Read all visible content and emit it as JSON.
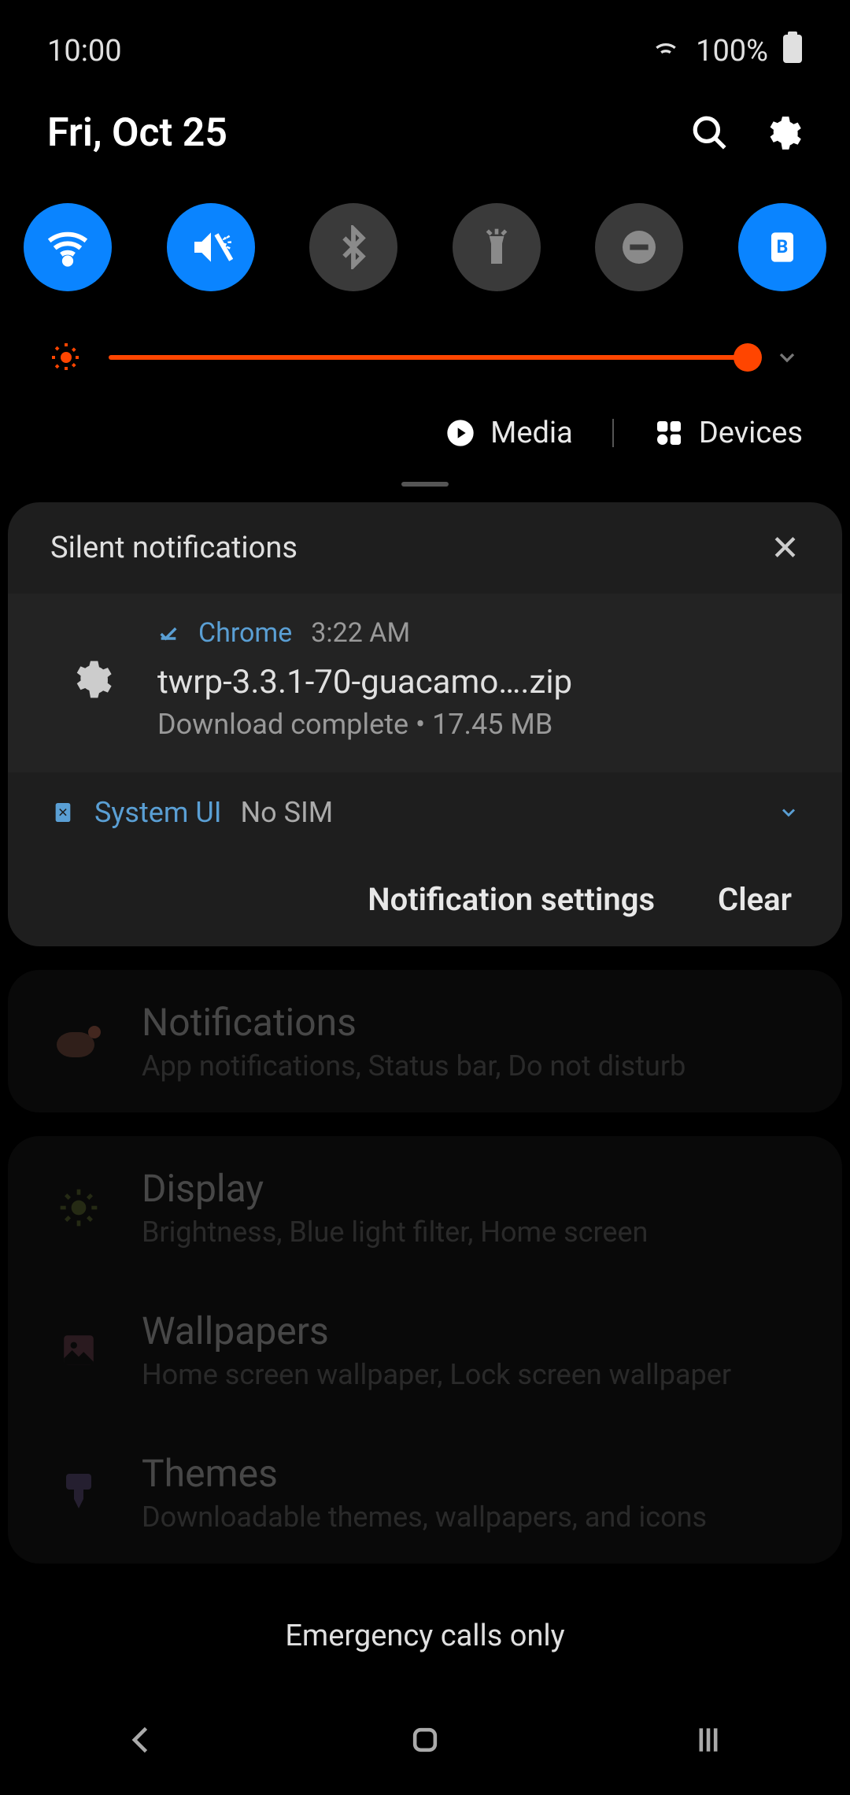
{
  "status": {
    "time": "10:00",
    "battery": "100%"
  },
  "date": "Fri, Oct 25",
  "media_row": {
    "media": "Media",
    "devices": "Devices"
  },
  "brightness": {
    "value_pct": 95
  },
  "toggles": [
    {
      "name": "wifi",
      "on": true
    },
    {
      "name": "mute-vibrate",
      "on": true
    },
    {
      "name": "bluetooth",
      "on": false
    },
    {
      "name": "flashlight",
      "on": false
    },
    {
      "name": "dnd",
      "on": false
    },
    {
      "name": "blue-light",
      "on": true
    }
  ],
  "silent_header": "Silent notifications",
  "notification": {
    "app": "Chrome",
    "time": "3:22 AM",
    "title": "twrp-3.3.1-70-guacamo….zip",
    "subtitle": "Download complete • 17.45 MB"
  },
  "system_notif": {
    "app": "System UI",
    "status": "No SIM"
  },
  "actions": {
    "settings": "Notification settings",
    "clear": "Clear"
  },
  "settings": [
    {
      "title": "Notifications",
      "sub": "App notifications, Status bar, Do not disturb",
      "icon": "notifications",
      "color": "#8a5a4a"
    },
    {
      "title": "Display",
      "sub": "Brightness, Blue light filter, Home screen",
      "icon": "display",
      "color": "#6a7a3a"
    },
    {
      "title": "Wallpapers",
      "sub": "Home screen wallpaper, Lock screen wallpaper",
      "icon": "wallpapers",
      "color": "#7a4a5a"
    },
    {
      "title": "Themes",
      "sub": "Downloadable themes, wallpapers, and icons",
      "icon": "themes",
      "color": "#6a5a8a"
    }
  ],
  "emergency": "Emergency calls only"
}
